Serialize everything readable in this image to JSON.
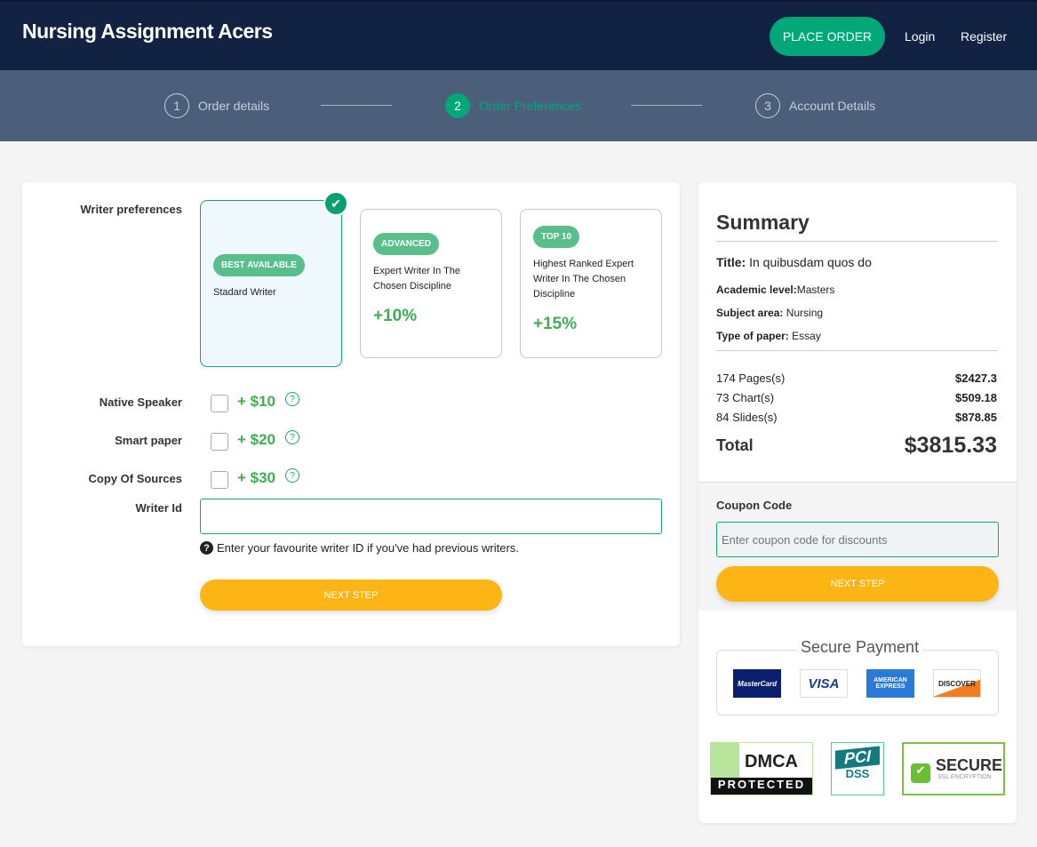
{
  "header": {
    "brand": "Nursing Assignment Acers",
    "place_order": "PLACE ORDER",
    "login": "Login",
    "register": "Register"
  },
  "steps": [
    {
      "num": "1",
      "label": "Order details"
    },
    {
      "num": "2",
      "label": "Order Preferences",
      "active": true
    },
    {
      "num": "3",
      "label": "Account Details"
    }
  ],
  "form": {
    "writer_pref_label": "Writer preferences",
    "writers": [
      {
        "badge": "BEST AVAILABLE",
        "desc": "Stadard Writer",
        "price": "",
        "selected": true
      },
      {
        "badge": "ADVANCED",
        "desc": "Expert Writer In The Chosen Discipline",
        "price": "+10%"
      },
      {
        "badge": "TOP 10",
        "desc": "Highest Ranked Expert Writer In The Chosen Discipline",
        "price": "+15%"
      }
    ],
    "addons": [
      {
        "label": "Native Speaker",
        "price": "+ $10",
        "checked": false
      },
      {
        "label": "Smart paper",
        "price": "+ $20",
        "checked": false
      },
      {
        "label": "Copy Of Sources",
        "price": "+ $30",
        "checked": false
      }
    ],
    "help_glyph": "?",
    "writer_id_label": "Writer Id",
    "writer_id_value": "",
    "writer_id_hint": "Enter your favourite writer ID if you've had previous writers.",
    "next": "NEXT STEP"
  },
  "summary": {
    "title": "Summary",
    "paper_title_label": "Title:",
    "paper_title": "In quibusdam quos do",
    "details": [
      {
        "k": "Academic level:",
        "v": "Masters"
      },
      {
        "k": "Subject area:",
        "v": "Nursing"
      },
      {
        "k": "Type of paper:",
        "v": "Essay"
      }
    ],
    "lines": [
      {
        "k": "174 Pages(s)",
        "v": "$2427.3"
      },
      {
        "k": "73 Chart(s)",
        "v": "$509.18"
      },
      {
        "k": "84 Slides(s)",
        "v": "$878.85"
      }
    ],
    "total_label": "Total",
    "total": "$3815.33",
    "coupon_label": "Coupon Code",
    "coupon_placeholder": "Enter coupon code for discounts",
    "next": "NEXT STEP",
    "secure_payment": "Secure Payment",
    "cards": [
      "MasterCard",
      "VISA",
      "AMERICAN EXPRESS",
      "DISCOVER"
    ],
    "seals": [
      {
        "top": "DMCA",
        "bottom": "PROTECTED"
      },
      {
        "top": "PCI",
        "bottom": "DSS"
      },
      {
        "top": "SECURE",
        "bottom": "SSL ENCRYPTION"
      }
    ]
  },
  "colors": {
    "navy": "#112242",
    "green": "#00a878",
    "yellow": "#fdb515",
    "steps_bg": "#4c5f7a"
  }
}
